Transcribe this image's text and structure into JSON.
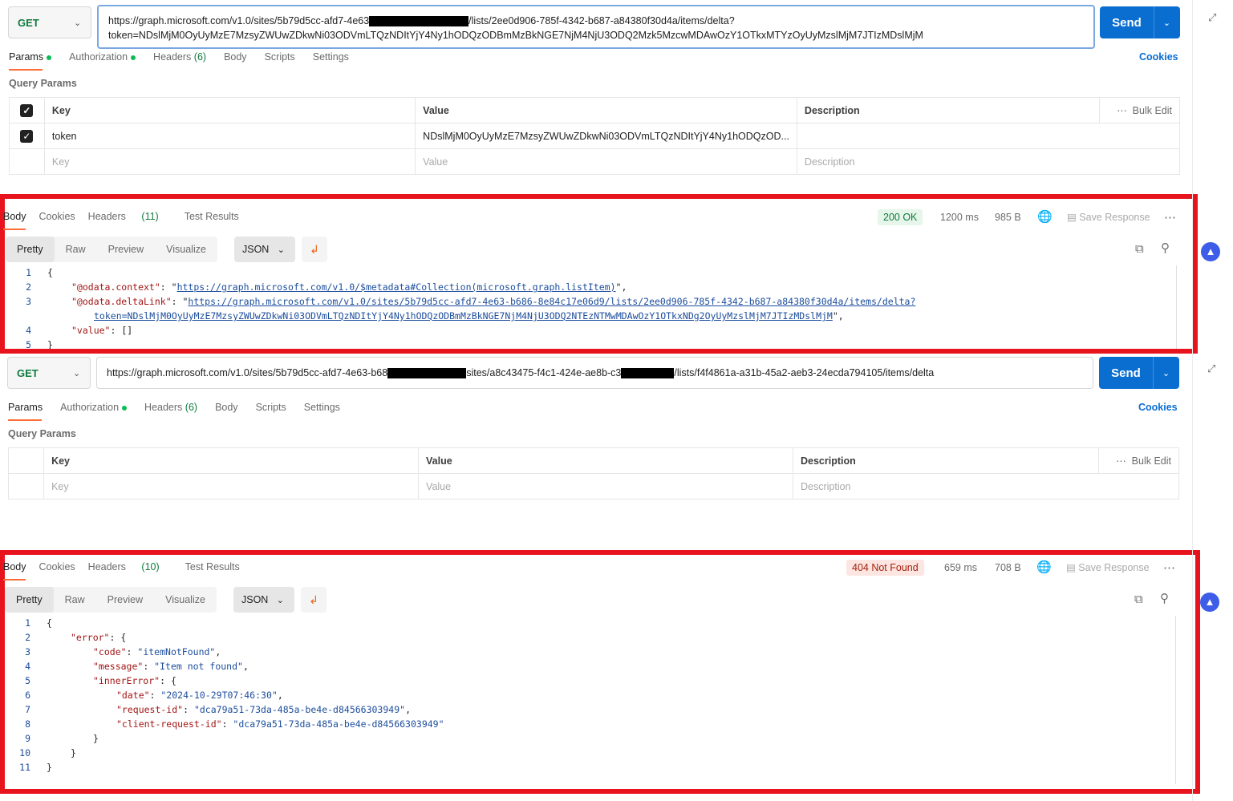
{
  "request1": {
    "method": "GET",
    "url_line1_a": "https://graph.microsoft.com/v1.0/sites/5b79d5cc-afd7-4e63",
    "url_line1_b": "/lists/2ee0d906-785f-4342-b687-a84380f30d4a/items/delta?",
    "url_line2": "token=NDslMjM0OyUyMzE7MzsyZWUwZDkwNi03ODVmLTQzNDItYjY4Ny1hODQzODBmMzBkNGE7NjM4NjU3ODQ2Mzk5MzcwMDAwOzY1OTkxMTYzOyUyMzslMjM7JTIzMDslMjM",
    "send": "Send",
    "tabs": {
      "params": "Params",
      "authorization": "Authorization",
      "headers": "Headers",
      "headers_count": "(6)",
      "body": "Body",
      "scripts": "Scripts",
      "settings": "Settings"
    },
    "cookies": "Cookies",
    "query_params_label": "Query Params",
    "table": {
      "headers": [
        "Key",
        "Value",
        "Description"
      ],
      "bulk_edit": "Bulk Edit",
      "row": {
        "key": "token",
        "value": "NDslMjM0OyUyMzE7MzsyZWUwZDkwNi03ODVmLTQzNDItYjY4Ny1hODQzOD..."
      },
      "placeholders": {
        "key": "Key",
        "value": "Value",
        "description": "Description"
      }
    }
  },
  "response1": {
    "tabs": {
      "body": "Body",
      "cookies": "Cookies",
      "headers": "Headers",
      "headers_count": "(11)",
      "tests": "Test Results"
    },
    "status": "200 OK",
    "time": "1200 ms",
    "size": "985 B",
    "save": "Save Response",
    "views": [
      "Pretty",
      "Raw",
      "Preview",
      "Visualize"
    ],
    "format": "JSON",
    "lines": [
      "1",
      "2",
      "3",
      "4",
      "5"
    ],
    "context_key": "\"@odata.context\"",
    "context_val": "https://graph.microsoft.com/v1.0/$metadata#Collection(microsoft.graph.listItem)",
    "delta_key": "\"@odata.deltaLink\"",
    "delta_val1": "https://graph.microsoft.com/v1.0/sites/5b79d5cc-afd7-4e63-b686-8e84c17e06d9/lists/2ee0d906-785f-4342-b687-a84380f30d4a/items/delta?",
    "delta_val2": "token=NDslMjM0OyUyMzE7MzsyZWUwZDkwNi03ODVmLTQzNDItYjY4Ny1hODQzODBmMzBkNGE7NjM4NjU3ODQ2NTEzNTMwMDAwOzY1OTkxNDg2OyUyMzslMjM7JTIzMDslMjM",
    "value_key": "\"value\"",
    "value_val": "[]"
  },
  "request2": {
    "method": "GET",
    "url_a": "https://graph.microsoft.com/v1.0/sites/5b79d5cc-afd7-4e63-b68",
    "url_b": "sites/a8c43475-f4c1-424e-ae8b-c3",
    "url_c": "/lists/f4f4861a-a31b-45a2-aeb3-24ecda794105/items/delta",
    "send": "Send",
    "tabs": {
      "params": "Params",
      "authorization": "Authorization",
      "headers": "Headers",
      "headers_count": "(6)",
      "body": "Body",
      "scripts": "Scripts",
      "settings": "Settings"
    },
    "cookies": "Cookies",
    "query_params_label": "Query Params",
    "table": {
      "headers": [
        "Key",
        "Value",
        "Description"
      ],
      "bulk_edit": "Bulk Edit",
      "placeholders": {
        "key": "Key",
        "value": "Value",
        "description": "Description"
      }
    }
  },
  "response2": {
    "tabs": {
      "body": "Body",
      "cookies": "Cookies",
      "headers": "Headers",
      "headers_count": "(10)",
      "tests": "Test Results"
    },
    "status": "404 Not Found",
    "time": "659 ms",
    "size": "708 B",
    "save": "Save Response",
    "views": [
      "Pretty",
      "Raw",
      "Preview",
      "Visualize"
    ],
    "format": "JSON",
    "lines": [
      "1",
      "2",
      "3",
      "4",
      "5",
      "6",
      "7",
      "8",
      "9",
      "10",
      "11"
    ],
    "error_key": "\"error\"",
    "code_key": "\"code\"",
    "code_val": "\"itemNotFound\"",
    "message_key": "\"message\"",
    "message_val": "\"Item not found\"",
    "inner_key": "\"innerError\"",
    "date_key": "\"date\"",
    "date_val": "\"2024-10-29T07:46:30\"",
    "reqid_key": "\"request-id\"",
    "reqid_val": "\"dca79a51-73da-485a-be4e-d84566303949\"",
    "clientid_key": "\"client-request-id\"",
    "clientid_val": "\"dca79a51-73da-485a-be4e-d84566303949\""
  },
  "colors": {
    "accent": "#0a6ed1",
    "frame": "#e8141d",
    "tab_active": "#ff6c37"
  }
}
